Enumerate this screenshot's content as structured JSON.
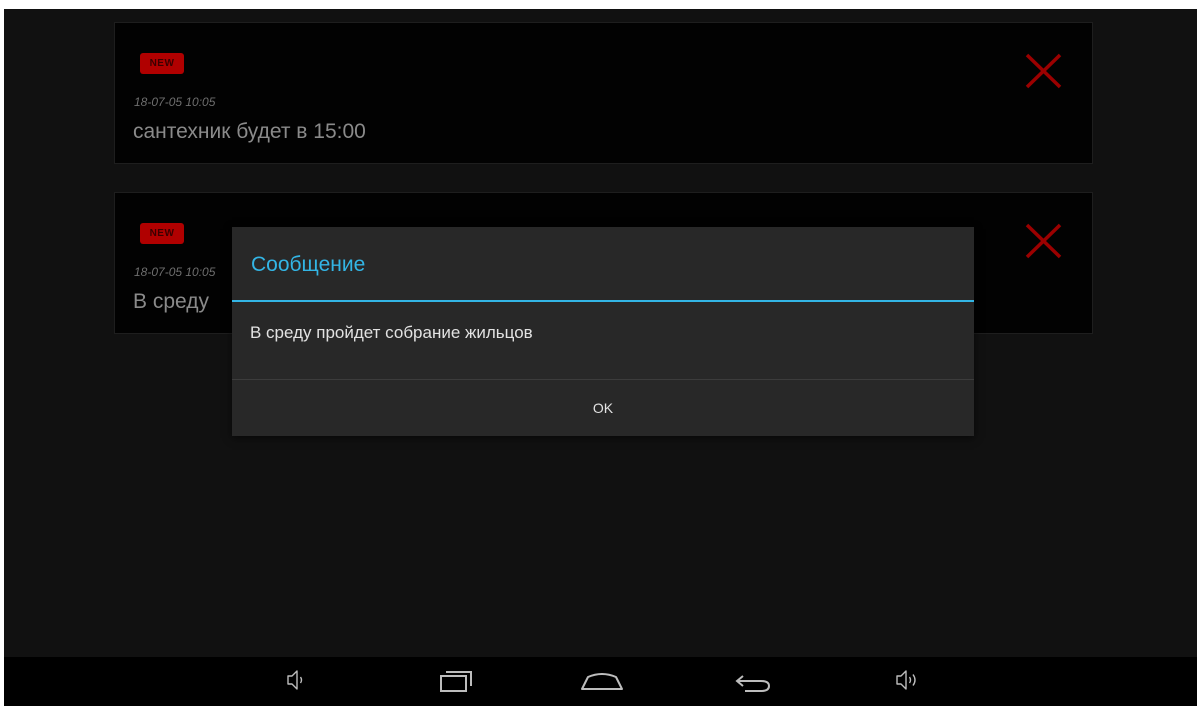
{
  "messages": [
    {
      "badge": "NEW",
      "time": "18-07-05 10:05",
      "text": "сантехник будет в 15:00",
      "close_icon": "close-x-icon"
    },
    {
      "badge": "NEW",
      "time": "18-07-05 10:05",
      "text": "В среду",
      "close_icon": "close-x-icon"
    }
  ],
  "dialog": {
    "title": "Сообщение",
    "message": "В среду пройдет собрание жильцов",
    "ok_label": "OK"
  },
  "navbar": {
    "icons": [
      "volume-down-icon",
      "recent-apps-icon",
      "home-icon",
      "back-icon",
      "volume-up-icon"
    ]
  },
  "colors": {
    "accent": "#33b5e5",
    "close": "#9b0000",
    "badge": "#b00000"
  }
}
